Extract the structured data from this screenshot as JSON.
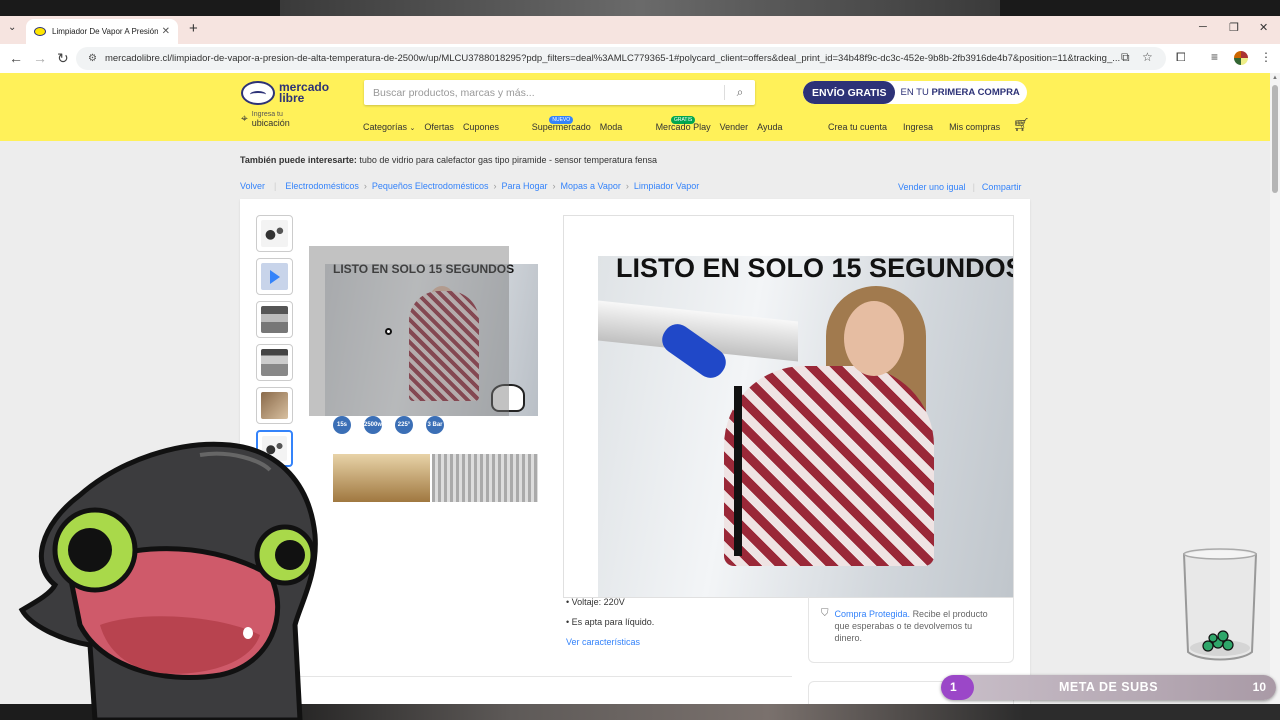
{
  "browser": {
    "tab_title": "Limpiador De Vapor A Presión D",
    "url": "mercadolibre.cl/limpiador-de-vapor-a-presion-de-alta-temperatura-de-2500w/up/MLCU3788018295?pdp_filters=deal%3AMLC779365-1#polycard_client=offers&deal_print_id=34b48f9c-dc3c-452e-9b8b-2fb3916de4b7&position=11&tracking_..."
  },
  "header": {
    "logo_line1": "mercado",
    "logo_line2": "libre",
    "search_placeholder": "Buscar productos, marcas y más...",
    "promo_a": "ENVÍO GRATIS",
    "promo_b_prefix": "EN TU",
    "promo_b_bold": "PRIMERA COMPRA",
    "location_line1": "Ingresa tu",
    "location_line2": "ubicación",
    "nav": {
      "categorias": "Categorías",
      "ofertas": "Ofertas",
      "cupones": "Cupones",
      "supermercado": "Supermercado",
      "supermercado_badge": "NUEVO",
      "moda": "Moda",
      "mercado_play": "Mercado Play",
      "mercado_play_badge": "GRATIS",
      "vender": "Vender",
      "ayuda": "Ayuda"
    },
    "account": {
      "crea": "Crea tu cuenta",
      "ingresa": "Ingresa",
      "compras": "Mis compras"
    }
  },
  "also_like": {
    "label": "También puede interesarte:",
    "text": "tubo de vidrio para calefactor gas tipo piramide - sensor temperatura fensa"
  },
  "breadcrumb": {
    "back": "Volver",
    "items": [
      "Electrodomésticos",
      "Pequeños Electrodomésticos",
      "Para Hogar",
      "Mopas a Vapor",
      "Limpiador Vapor"
    ],
    "sell": "Vender uno igual",
    "share": "Compartir"
  },
  "product": {
    "image_heading": "LISTO EN SOLO 15 SEGUNDOS",
    "zoom_heading": "LISTO EN SOLO 15 SEGUNDOS",
    "spec_icons": [
      "15s",
      "2500w",
      "225°",
      "3 Bar"
    ],
    "features": [
      "Voltaje: 220V",
      "Es apta para líquido."
    ],
    "see_features": "Ver características"
  },
  "protection": {
    "link": "Compra Protegida.",
    "text": "Recibe el producto que esperabas o te devolvemos tu dinero."
  },
  "overlay": {
    "goal_label": "META DE SUBS",
    "goal_current": "1",
    "goal_target": "10",
    "goal_progress": 0.1
  },
  "colors": {
    "ml_yellow": "#fff159",
    "ml_blue": "#3483fa",
    "ml_navy": "#2d3277",
    "goal_purple": "#9b47c8"
  }
}
